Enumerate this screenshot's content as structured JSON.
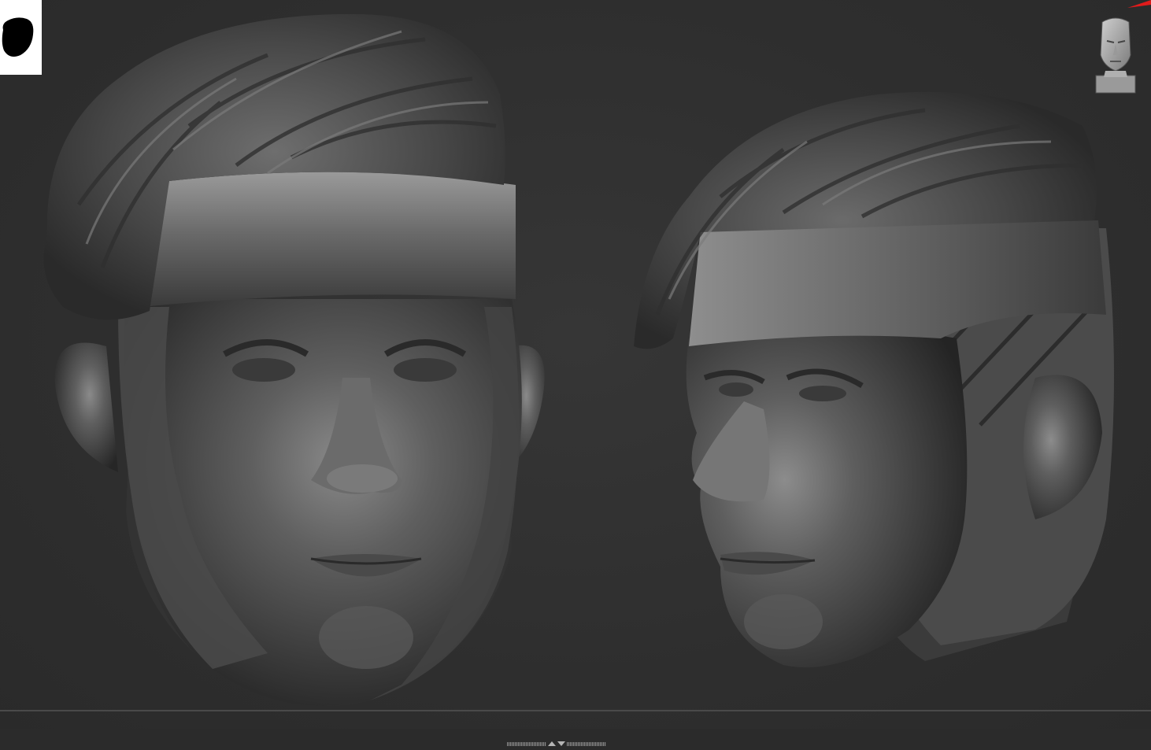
{
  "canvas": {
    "background": "#2f2f2f",
    "models": [
      {
        "view": "front",
        "material": "matcap-gray",
        "color": "#5a5a5a"
      },
      {
        "view": "three-quarter",
        "material": "matcap-gray",
        "color": "#5a5a5a"
      }
    ]
  },
  "toolbar": {
    "brush_alpha_icon": "brush-alpha-icon",
    "navigation_icon": "head-navigation-icon",
    "splitter_icon": "splitter-arrows-icon",
    "accent_color": "#e01b1b"
  }
}
